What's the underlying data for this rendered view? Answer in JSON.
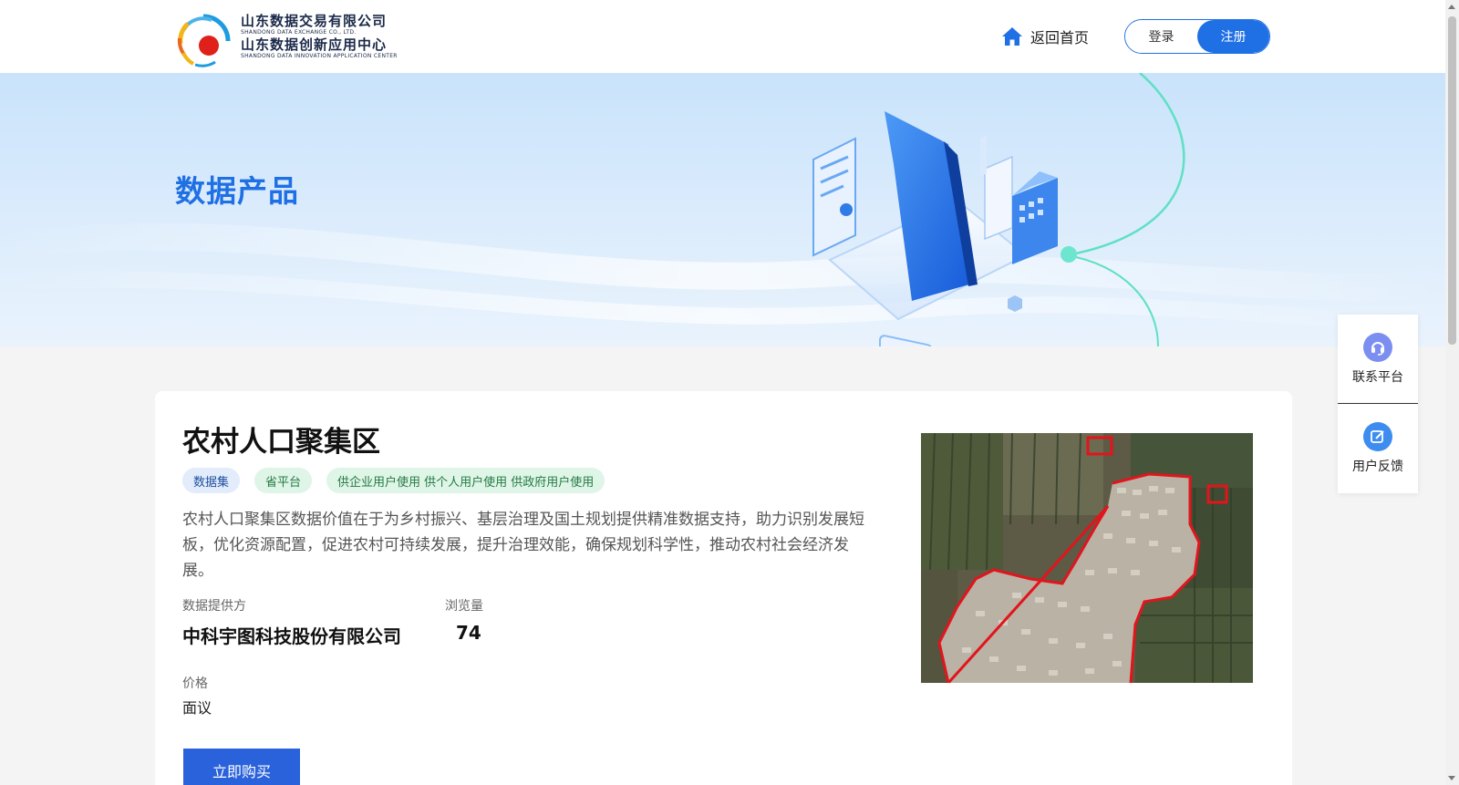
{
  "header": {
    "logo_cn_1": "山东数据交易有限公司",
    "logo_en_1": "SHANDONG DATA EXCHANGE CO., LTD.",
    "logo_cn_2": "山东数据创新应用中心",
    "logo_en_2": "SHANDONG DATA INNOVATION APPLICATION CENTER",
    "home_label": "返回首页",
    "login_label": "登录",
    "register_label": "注册"
  },
  "banner": {
    "title": "数据产品"
  },
  "product": {
    "title": "农村人口聚集区",
    "tags": [
      "数据集",
      "省平台",
      "供企业用户使用 供个人用户使用 供政府用户使用"
    ],
    "description": "农村人口聚集区数据价值在于为乡村振兴、基层治理及国土规划提供精准数据支持，助力识别发展短板，优化资源配置，促进农村可持续发展，提升治理效能，确保规划科学性，推动农村社会经济发展。",
    "provider_label": "数据提供方",
    "provider_value": "中科宇图科技股份有限公司",
    "views_label": "浏览量",
    "views_value": "74",
    "price_label": "价格",
    "price_value": "面议",
    "buy_label": "立即购买"
  },
  "float_bar": {
    "contact_label": "联系平台",
    "feedback_label": "用户反馈"
  },
  "colors": {
    "accent": "#1f6fe5",
    "buy_button": "#2a62db",
    "tag_blue_bg": "#e2ecfb",
    "tag_green_bg": "#dff5e7"
  }
}
